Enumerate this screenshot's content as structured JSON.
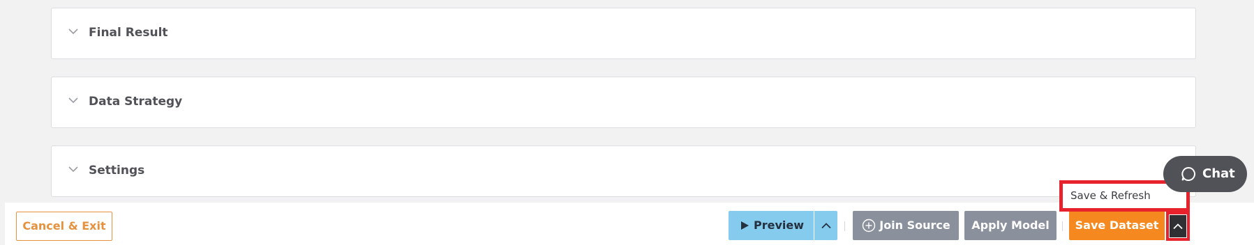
{
  "sections": [
    {
      "title": "Final Result"
    },
    {
      "title": "Data Strategy"
    },
    {
      "title": "Settings"
    }
  ],
  "action_bar": {
    "cancel_label": "Cancel & Exit",
    "preview_label": "Preview",
    "join_label": "Join Source",
    "apply_label": "Apply Model",
    "save_label": "Save Dataset"
  },
  "dropdown": {
    "items": [
      "Save & Refresh"
    ]
  },
  "chat": {
    "label": "Chat"
  },
  "icons": {
    "chevron": "chevron-down-icon",
    "play": "play-icon",
    "caret": "chevron-up-icon",
    "plus": "plus-circle-icon",
    "chat": "chat-bubble-icon"
  },
  "colors": {
    "accent_orange": "#f5891f",
    "preview_blue": "#85cbee",
    "gray_button": "#8b919c",
    "highlight_red": "#e8222c",
    "chat_bg": "#505257"
  }
}
